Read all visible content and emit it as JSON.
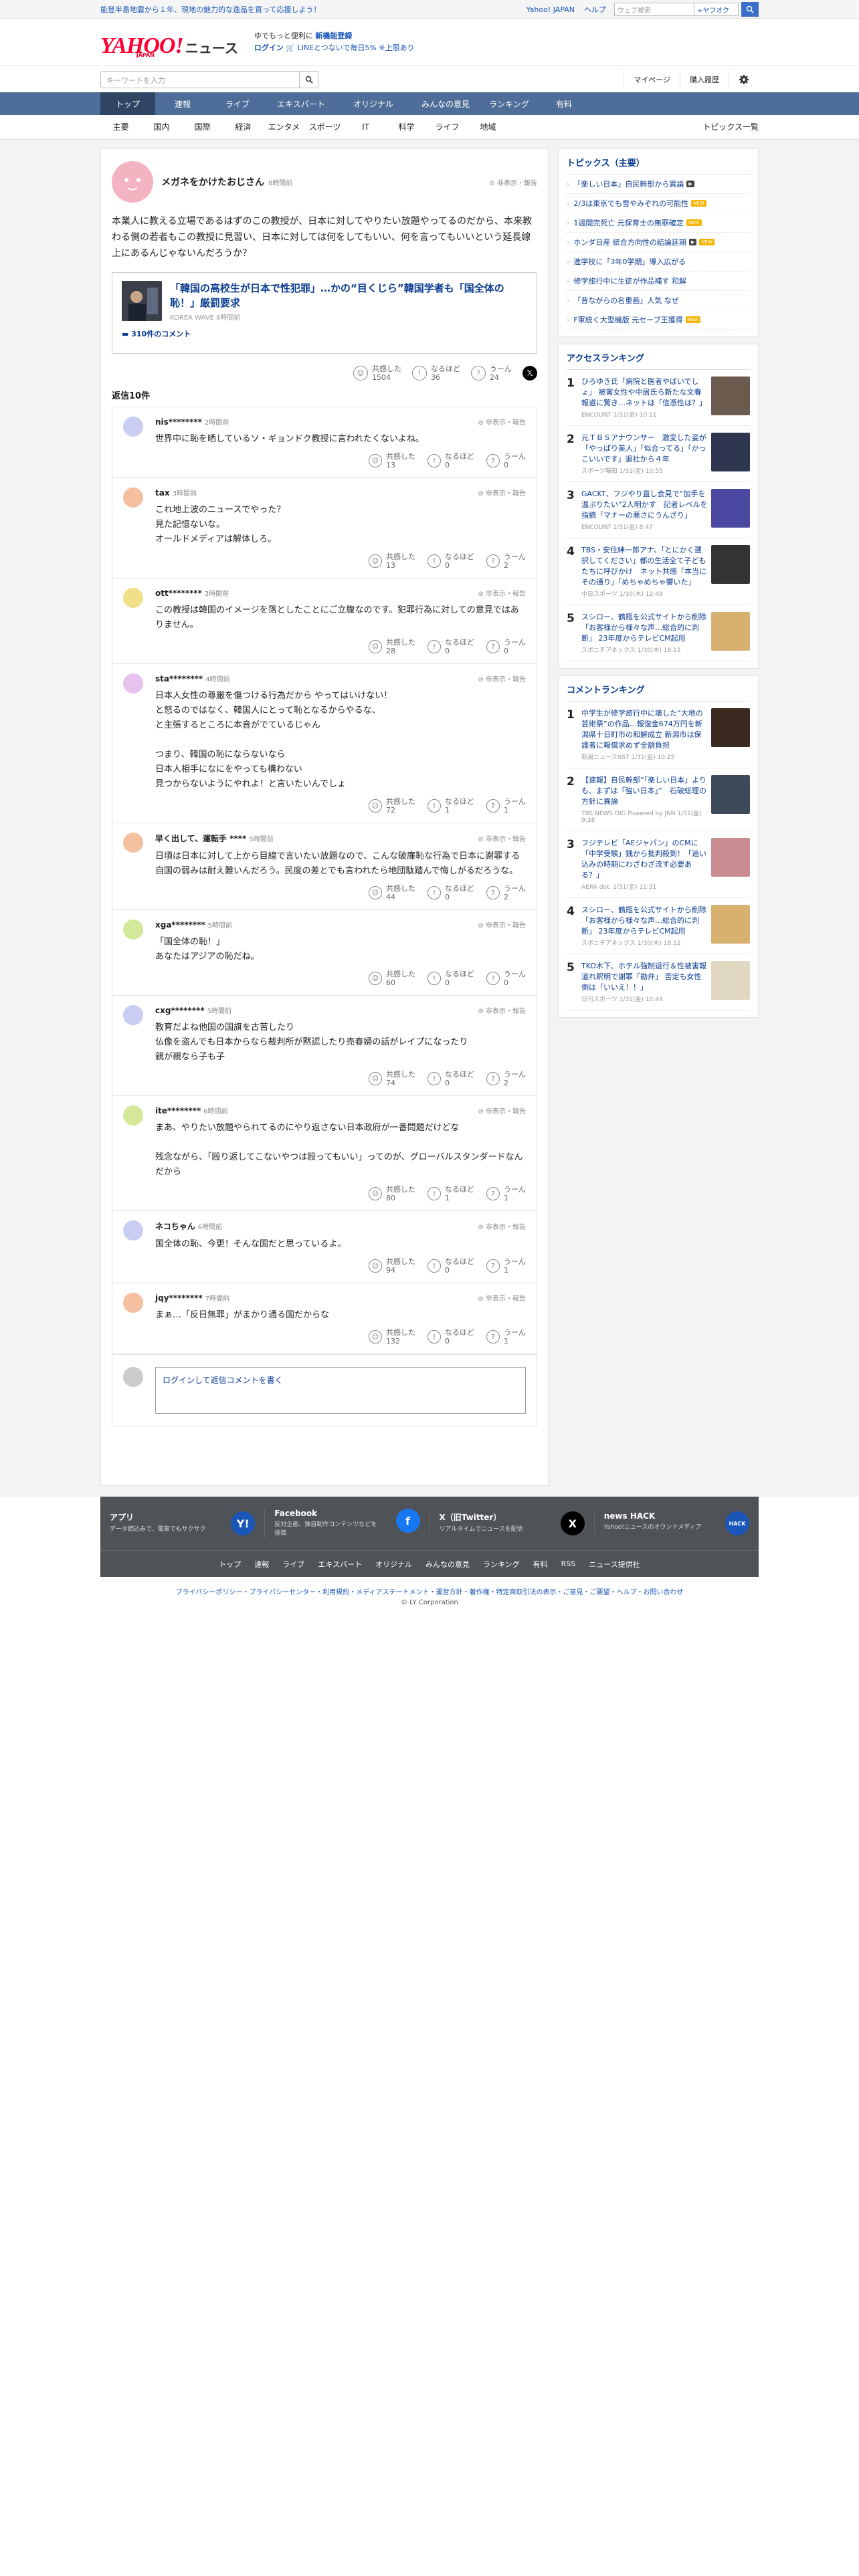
{
  "topbar": {
    "promo": "能登半島地震から１年、現地の魅力的な逸品を買って応援しよう！",
    "links": [
      "Yahoo! JAPAN",
      "ヘルプ"
    ],
    "search_placeholder": "ウェブ検索",
    "search_scope": "+ヤフオク",
    "search_scope_hint": ""
  },
  "header": {
    "logo": "YAHOO!",
    "logo_sub": "JAPAN",
    "service": "ニュース",
    "msg1": "ゆでもっと便利に",
    "msg1_link": "新機能登録",
    "msg2": "ログイン",
    "msg2b": "LINEとつないで毎日5%",
    "msg2c": "上限あり"
  },
  "search": {
    "placeholder": "キーワードを入力",
    "right": [
      "マイページ",
      "購入履歴"
    ]
  },
  "nav": [
    "トップ",
    "速報",
    "ライブ",
    "エキスパート",
    "オリジナル",
    "みんなの意見",
    "ランキング",
    "有料"
  ],
  "subnav": [
    "主要",
    "国内",
    "国際",
    "経済",
    "エンタメ",
    "スポーツ",
    "IT",
    "科学",
    "ライフ",
    "地域"
  ],
  "subnav_last": "トピックス一覧",
  "post": {
    "name": "メガネをかけたおじさん",
    "time": "8時間前",
    "report": "非表示・報告",
    "body": "本業人に教える立場であるはずのこの教授が、日本に対してやりたい放題やってるのだから、本来教わる側の若者もこの教授に見習い、日本に対しては何をしてもいい、何を言ってもいいという延長線上にあるんじゃないんだろうか？",
    "article": {
      "title": "「韓国の高校生が日本で性犯罪」…かの“目くじら”韓国学者も「国全体の恥！」厳罰要求",
      "source": "KOREA WAVE",
      "source_time": "8時間前",
      "comments": "310件のコメント"
    },
    "reactions": [
      {
        "label": "共感した",
        "count": "1504"
      },
      {
        "label": "なるほど",
        "count": "36"
      },
      {
        "label": "うーん",
        "count": "24"
      }
    ]
  },
  "replies_title": "返信10件",
  "replies": [
    {
      "name": "nis********",
      "time": "2時間前",
      "text": "世界中に恥を晒しているソ・ギョンドク教授に言われたくないよね。",
      "color": "#c9cdf2",
      "counts": [
        "13",
        "0",
        "0"
      ]
    },
    {
      "name": "tax",
      "time": "3時間前",
      "text": "これ地上波のニュースでやった？\n見た記憶ないな。\nオールドメディアは解体しろ。",
      "color": "#f5c0a0",
      "counts": [
        "13",
        "0",
        "2"
      ]
    },
    {
      "name": "ott********",
      "time": "3時間前",
      "text": "この教授は韓国のイメージを落としたことにご立腹なのです。犯罪行為に対しての意見ではありません。",
      "color": "#f0e08a",
      "counts": [
        "28",
        "0",
        "0"
      ]
    },
    {
      "name": "sta********",
      "time": "4時間前",
      "text": "日本人女性の尊厳を傷つける行為だから やってはいけない！\nと怒るのではなく、韓国人にとって恥となるからやるな、\nと主張するところに本音がでているじゃん\n\nつまり、韓国の恥にならないなら\n日本人相手になにをやっても構わない\n見つからないようにやれよ！と言いたいんでしょ",
      "color": "#e6c2ee",
      "counts": [
        "72",
        "1",
        "1"
      ]
    },
    {
      "name": "早く出して、運転手 ****",
      "time": "5時間前",
      "text": "日頃は日本に対して上から目線で言いたい放題なので、こんな破廉恥な行為で日本に謝罪する自国の弱みは耐え難いんだろう。民度の差とでも言われたら地団駄踏んで悔しがるだろうな。",
      "color": "#f5c0a0",
      "counts": [
        "44",
        "0",
        "2"
      ]
    },
    {
      "name": "xga********",
      "time": "5時間前",
      "text": "「国全体の恥！」\nあなたはアジアの恥だね。",
      "color": "#d4e89a",
      "counts": [
        "60",
        "0",
        "0"
      ]
    },
    {
      "name": "cxg********",
      "time": "5時間前",
      "text": "教育だよね他国の国旗を古苦したり\n仏像を盗んでも日本からなら裁判所が黙認したり売春婦の話がレイプになったり\n親が親なら子も子",
      "color": "#c9cdf2",
      "counts": [
        "74",
        "0",
        "2"
      ]
    },
    {
      "name": "ite********",
      "time": "6時間前",
      "text": "まあ、やりたい放題やられてるのにやり返さない日本政府が一番問題だけどな\n\n残念ながら、「殴り返してこないやつは殴ってもいい」ってのが、グローバルスタンダードなんだから",
      "color": "#d4e89a",
      "counts": [
        "80",
        "1",
        "1"
      ]
    },
    {
      "name": "ネコちゃん",
      "time": "6時間前",
      "text": "国全体の恥、今更！そんな国だと思っているよ。",
      "color": "#c9cdf2",
      "counts": [
        "94",
        "0",
        "1"
      ]
    },
    {
      "name": "jqy********",
      "time": "7時間前",
      "text": "まぁ…「反日無罪」がまかり通る国だからな",
      "color": "#f5c0a0",
      "counts": [
        "132",
        "0",
        "1"
      ]
    }
  ],
  "reaction_labels": [
    "共感した",
    "なるほど",
    "うーん"
  ],
  "write_prompt": "ログイン",
  "write_prompt_rest": "して返信コメントを書く",
  "topics": {
    "title": "トピックス（主要）",
    "items": [
      {
        "text": "「楽しい日本」自民幹部から異論",
        "badge": "vid"
      },
      {
        "text": "2/3は東京でも雪やみぞれの可能性",
        "badge": "new"
      },
      {
        "text": "1週間完死亡 元保育士の無罪確定",
        "badge": "new"
      },
      {
        "text": "ホンダ日産 統合方向性の結論延期",
        "badge": "vid new"
      },
      {
        "text": "進学校に「3年0学期」導入広がる",
        "badge": ""
      },
      {
        "text": "修学旅行中に生徒が作品補す 和解",
        "badge": ""
      },
      {
        "text": "「昔ながらの名重画」人気 なぜ",
        "badge": ""
      },
      {
        "text": "F軍統く大型機版 元セーブ王獲得",
        "badge": "new"
      }
    ]
  },
  "access": {
    "title": "アクセスランキング",
    "items": [
      {
        "no": "1",
        "title": "ひろゆき氏「病院と医者やばいでしょ」 被害女性や中居氏ら新たな文春報道に驚き…ネットは「信憑性は？」",
        "meta": "ENCOUNT 1/31(金) 10:11",
        "color": "#6b5a4e"
      },
      {
        "no": "2",
        "title": "元ＴＢＳアナウンサー　激変した姿が「やっぱり美人」「似合ってる」「かっこいいです」退社から４年",
        "meta": "スポーツ報知 1/31(金) 10:55",
        "color": "#2f3750"
      },
      {
        "no": "3",
        "title": "GACKT、フジやり直し会見で“加手を温ぶりたい”2人明かす　記者レベルを指摘「マナーの悪さにうんざり」",
        "meta": "ENCOUNT 1/31(金) 8:47",
        "color": "#4a48a0"
      },
      {
        "no": "4",
        "title": "TBS・安住紳一郎アナ、「とにかく選択してください」都の生活全て子どもたちに呼びかけ　ネット共感「本当にその通り」「めちゃめちゃ響いた」",
        "meta": "中日スポーツ 1/30(木) 12:49",
        "color": "#333333"
      },
      {
        "no": "5",
        "title": "スシロー、鶴瓶を公式サイトから削除 「お客様から様々な声…総合的に判断」 23年度からテレビCM起用",
        "meta": "スポニチアネックス 1/30(木) 18:12",
        "color": "#d8b070"
      }
    ]
  },
  "comment_rank": {
    "title": "コメントランキング",
    "items": [
      {
        "no": "1",
        "title": "中学生が修学旅行中に壊した“大地の芸術祭”の作品…報復金674万円を新潟県十日町市の和解成立 新潟市は保護者に報償求めず全額負担",
        "meta": "新潟ニュースNST 1/31(金) 10:25",
        "color": "#3b2a20"
      },
      {
        "no": "2",
        "title": "【速報】自民幹部“「楽しい日本」よりも、まずは「強い日本」”　石破総理の方針に異論",
        "meta": "TBS NEWS DIG Powered by JNN 1/31(金) 9:28",
        "color": "#3d4a5a"
      },
      {
        "no": "3",
        "title": "フジテレビ「AEジャパン」のCMに「中学受験」銭から批判殺到！「追い込みの時期にわざわざ流す必要ある？」",
        "meta": "AERA dot. 1/31(金) 11:31",
        "color": "#c98a90"
      },
      {
        "no": "4",
        "title": "スシロー、鶴瓶を公式サイトから削除 「お客様から様々な声…総合的に判断」 23年度からテレビCM起用",
        "meta": "スポニチアネックス 1/30(木) 18:12",
        "color": "#d8b070"
      },
      {
        "no": "5",
        "title": "TKO木下、ホテル強制退行＆性被害報道れ釈明で謝罪「勘弁」 否定も女性側は「いいえ！！」",
        "meta": "日刊スポーツ 1/31(金) 10:44",
        "color": "#e0d8c0"
      }
    ]
  },
  "footer": {
    "cells": [
      {
        "title": "アプリ",
        "desc": "データ読込みで、電車でもサクサク",
        "icon": "Y!",
        "color": "#1a56b8"
      },
      {
        "title": "Facebook",
        "desc": "反対企画、独自制作コンテンツなどを投稿",
        "icon": "f",
        "color": "#1877f2"
      },
      {
        "title": "X（旧Twitter）",
        "desc": "リアルタイムでニュースを配信",
        "icon": "X",
        "color": "#000000"
      },
      {
        "title": "news HACK",
        "desc": "Yahoo!ニュースのオウンドメディア",
        "icon": "HACK",
        "color": "#1a56b8"
      }
    ],
    "nav": [
      "トップ",
      "速報",
      "ライブ",
      "エキスパート",
      "オリジナル",
      "みんなの意見",
      "ランキング",
      "有料",
      "RSS",
      "ニュース提供社"
    ],
    "legal": "プライバシーポリシー・プライバシーセンター・利用規約・メディアステートメント・運営方針・著作権・特定商取引法の表示・ご意見・ご要望・ヘルプ・お問い合わせ",
    "copy": "© LY Corporation"
  }
}
